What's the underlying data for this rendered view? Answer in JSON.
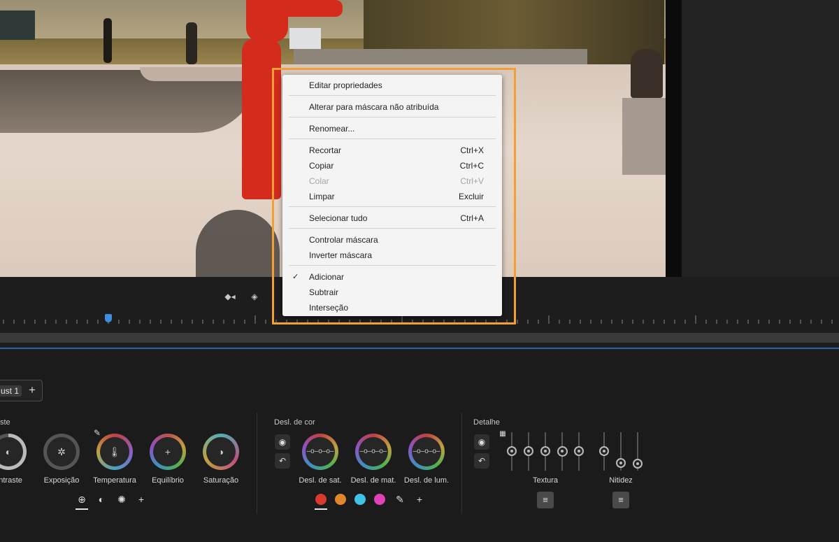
{
  "menu": {
    "items": [
      {
        "label": "Editar propriedades",
        "shortcut": ""
      },
      {
        "label": "Alterar para máscara não atribuída",
        "shortcut": ""
      },
      {
        "label": "Renomear...",
        "shortcut": ""
      },
      {
        "label": "Recortar",
        "shortcut": "Ctrl+X"
      },
      {
        "label": "Copiar",
        "shortcut": "Ctrl+C"
      },
      {
        "label": "Colar",
        "shortcut": "Ctrl+V",
        "disabled": true
      },
      {
        "label": "Limpar",
        "shortcut": "Excluir"
      },
      {
        "label": "Selecionar tudo",
        "shortcut": "Ctrl+A"
      },
      {
        "label": "Controlar máscara",
        "shortcut": ""
      },
      {
        "label": "Inverter máscara",
        "shortcut": ""
      },
      {
        "label": "Adicionar",
        "shortcut": "",
        "checked": true
      },
      {
        "label": "Subtrair",
        "shortcut": ""
      },
      {
        "label": "Interseção",
        "shortcut": ""
      }
    ],
    "check_glyph": "✓"
  },
  "tabs": {
    "active_label": "ust 1",
    "add_glyph": "+"
  },
  "sections": {
    "adjust_title": "ste",
    "color_shift_title": "Desl. de cor",
    "detail_title": "Detalhe"
  },
  "adjust_dials": [
    {
      "label": "ontraste",
      "icon": "contrast-icon",
      "glyph": "◐"
    },
    {
      "label": "Exposição",
      "icon": "aperture-icon",
      "glyph": "✲"
    },
    {
      "label": "Temperatura",
      "icon": "thermometer-icon",
      "glyph": "🌡"
    },
    {
      "label": "Equilíbrio",
      "icon": "plus-icon",
      "glyph": "+"
    },
    {
      "label": "Saturação",
      "icon": "saturation-icon",
      "glyph": "◑"
    }
  ],
  "color_shift_dials": [
    {
      "label": "Desl. de sat."
    },
    {
      "label": "Desl. de mat."
    },
    {
      "label": "Desl. de lum."
    }
  ],
  "detail": {
    "texture_label": "Textura",
    "sharpness_label": "Nitidez"
  },
  "colors": {
    "highlight": "#f2a033",
    "playhead": "#3d8ee0",
    "swatch_red": "#d93a2b",
    "swatch_orange": "#e0872b",
    "swatch_cyan": "#3ec3e6",
    "swatch_magenta": "#e040b8"
  },
  "glyphs": {
    "plus": "+",
    "eye": "◉",
    "reset": "↶",
    "settings": "≡",
    "eyedropper": "✎",
    "globe": "⊕",
    "half": "◐",
    "sun": "✺"
  }
}
